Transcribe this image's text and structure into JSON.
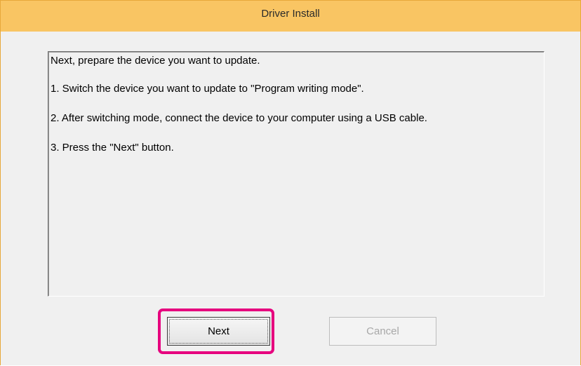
{
  "window": {
    "title": "Driver Install"
  },
  "instructions": {
    "lines": [
      "Next, prepare the device you want to update.",
      "1. Switch the device you want to update to \"Program writing mode\".",
      "2. After switching mode, connect the device to your computer using a USB cable.",
      "3. Press the \"Next\" button."
    ]
  },
  "buttons": {
    "next_label": "Next",
    "cancel_label": "Cancel",
    "cancel_enabled": false
  },
  "colors": {
    "titlebar": "#f9c563",
    "highlight": "#e6007e",
    "dialog_background": "#f0f0f0"
  }
}
